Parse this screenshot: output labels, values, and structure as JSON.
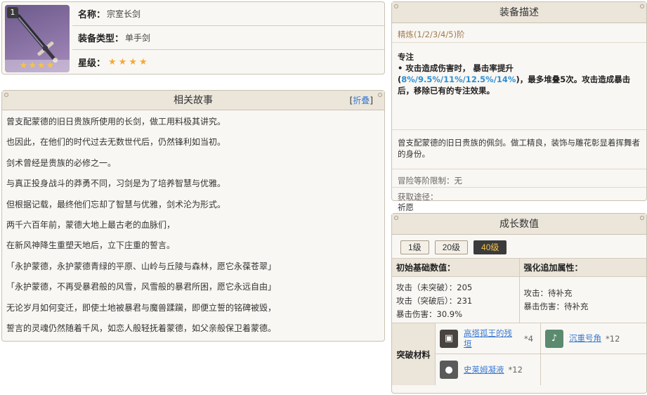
{
  "info": {
    "badge": "1",
    "thumb_stars": "★★★★",
    "name_key": "名称：",
    "name_value": "宗室长剑",
    "type_key": "装备类型：",
    "type_value": "单手剑",
    "rarity_key": "星级：",
    "rarity_stars": "★★★★"
  },
  "story": {
    "title": "相关故事",
    "fold_open": "[",
    "fold_label": "折叠",
    "fold_close": "]",
    "lines": [
      "曾支配蒙德的旧日贵族所使用的长剑，做工用料极其讲究。",
      "也因此，在他们的时代过去无数世代后，仍然锋利如当初。",
      "剑术曾经是贵族的必修之一。",
      "与真正投身战斗的莽勇不同，习剑是为了培养智慧与优雅。",
      "但根据记载，最终他们忘却了智慧与优雅，剑术沦为形式。",
      "两千六百年前，蒙德大地上最古老的血脉们，",
      "在新风神降生重塑天地后，立下庄重的誓言。",
      "「永护蒙德，永护蒙德青绿的平原、山岭与丘陵与森林，愿它永葆苍翠」",
      "「永护蒙德，不再受暴君般的风雪，风雪般的暴君所困，愿它永远自由」",
      "无论岁月如何变迁，即使土地被暴君与魔兽蹂躏，即便立誓的铭碑被毁，",
      "誓言的灵魂仍然随着千风，如恋人般轻抚着蒙德，如父亲般保卫着蒙德。"
    ]
  },
  "desc": {
    "title": "装备描述",
    "refine": "精炼(1/2/3/4/5)阶",
    "effect_title": "专注",
    "effect_pre": "• 攻击造成伤害时， 暴击率提升(",
    "effect_nums": "8%/9.5%/11%/12.5%/14%",
    "effect_post": ")，最多堆叠5次。攻击造成暴击后，移除已有的专注效果。",
    "flavor": "曾支配蒙德的旧日贵族的佩剑。做工精良，装饰与雕花彰显着挥舞者的身份。",
    "limit": "冒险等阶限制：无",
    "obtain_label": "获取途径：",
    "obtain_value": "祈愿"
  },
  "growth": {
    "title": "成长数值",
    "levels": [
      "1级",
      "20级",
      "40级"
    ],
    "active_level": "40级",
    "base_head": "初始基础数值：",
    "base_lines": [
      "攻击（未突破）：205",
      "攻击（突破后）：231",
      "暴击伤害：30.9%"
    ],
    "bonus_head": "强化追加属性：",
    "bonus_lines": [
      "攻击：待补充",
      "暴击伤害：待补充"
    ],
    "mats_label": "突破材料",
    "mats": [
      {
        "name": "高塔孤王的残垣",
        "count": "*4",
        "icon": "tower-fragment-icon",
        "color": "#4a4440"
      },
      {
        "name": "沉重号角",
        "count": "*12",
        "icon": "heavy-horn-icon",
        "color": "#5b8a6e"
      },
      {
        "name": "史莱姆凝液",
        "count": "*12",
        "icon": "slime-condensate-icon",
        "color": "#5a5a5a"
      }
    ]
  }
}
